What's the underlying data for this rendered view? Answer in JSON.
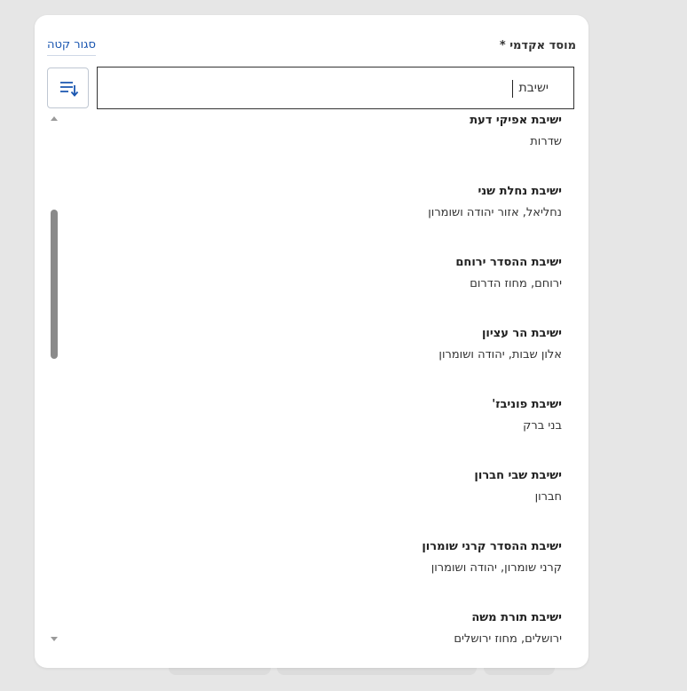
{
  "field": {
    "label": "מוסד אקדמי *",
    "close_label": "סגור קטה"
  },
  "search": {
    "value": "ישיבת",
    "placeholder": ""
  },
  "sort_button": {
    "icon": "sort-list-icon"
  },
  "results": [
    {
      "name": "ישיבת אפיקי דעת",
      "location": "שדרות"
    },
    {
      "name": "ישיבת נחלת שני",
      "location": "נחליאל, אזור יהודה ושומרון"
    },
    {
      "name": "ישיבת ההסדר ירוחם",
      "location": "ירוחם, מחוז הדרום"
    },
    {
      "name": "ישיבת הר עציון",
      "location": "אלון שבות, יהודה ושומרון"
    },
    {
      "name": "ישיבת פוניבז'",
      "location": "בני ברק"
    },
    {
      "name": "ישיבת שבי חברון",
      "location": "חברון"
    },
    {
      "name": "ישיבת ההסדר קרני שומרון",
      "location": "קרני שומרון, יהודה ושומרון"
    },
    {
      "name": "ישיבת תורת משה",
      "location": "ירושלים, מחוז ירושלים"
    }
  ],
  "colors": {
    "accent": "#1a56b0",
    "scroll_thumb": "#8a8a8a",
    "backdrop": "#e6e6e6"
  }
}
